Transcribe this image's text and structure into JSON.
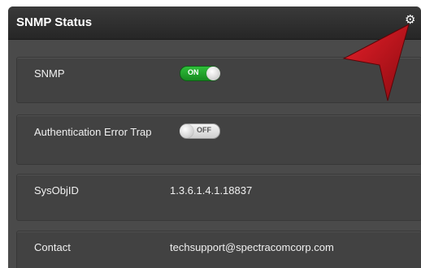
{
  "panel": {
    "title": "SNMP Status",
    "settings_icon": "gear-icon"
  },
  "rows": [
    {
      "label": "SNMP",
      "toggle": {
        "state": "on",
        "text": "ON"
      }
    },
    {
      "label": "Authentication Error Trap",
      "toggle": {
        "state": "off",
        "text": "OFF"
      }
    },
    {
      "label": "SysObjID",
      "value": "1.3.6.1.4.1.18837"
    },
    {
      "label": "Contact",
      "value": "techsupport@spectracomcorp.com"
    }
  ],
  "colors": {
    "panel_bg": "#4a4a4a",
    "toggle_on": "#22a82d",
    "annotation_arrow": "#c8101a"
  }
}
